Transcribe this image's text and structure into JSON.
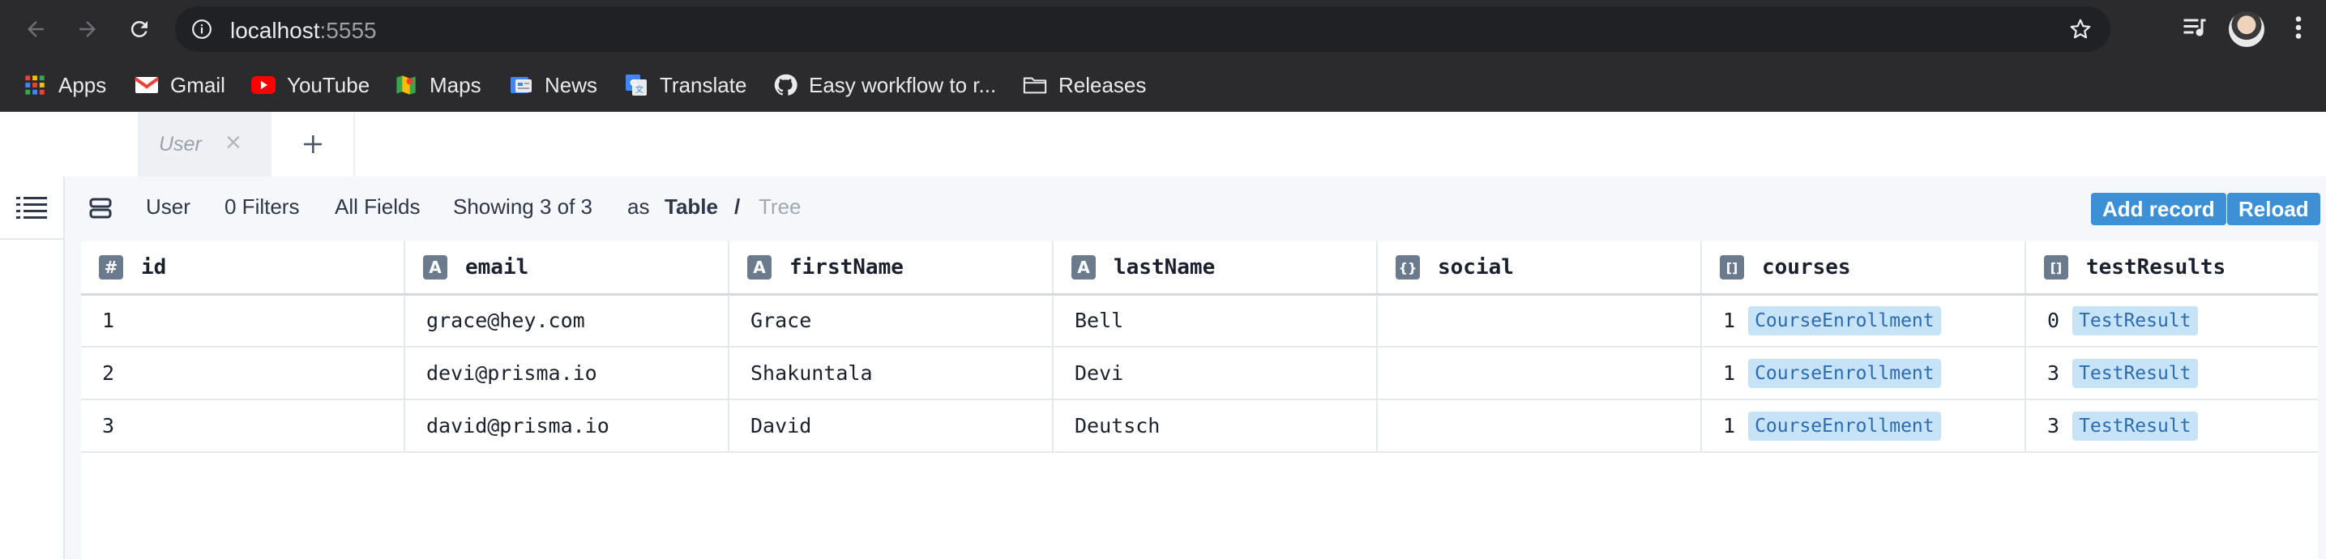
{
  "browser": {
    "url_host": "localhost",
    "url_port": ":5555",
    "bookmarks": [
      {
        "label": "Apps",
        "icon": "apps-grid-icon"
      },
      {
        "label": "Gmail",
        "icon": "gmail-icon"
      },
      {
        "label": "YouTube",
        "icon": "youtube-icon"
      },
      {
        "label": "Maps",
        "icon": "maps-icon"
      },
      {
        "label": "News",
        "icon": "news-icon"
      },
      {
        "label": "Translate",
        "icon": "translate-icon"
      },
      {
        "label": "Easy workflow to r...",
        "icon": "github-icon"
      },
      {
        "label": "Releases",
        "icon": "folder-icon"
      }
    ]
  },
  "tabs": {
    "active_label": "User",
    "close_glyph": "×",
    "add_glyph": "+"
  },
  "toolbar": {
    "model": "User",
    "filters": "0 Filters",
    "fields": "All Fields",
    "showing": "Showing 3 of 3",
    "as_label": "as",
    "view_table": "Table",
    "view_sep": "/",
    "view_tree": "Tree",
    "add_record": "Add record",
    "reload": "Reload"
  },
  "table": {
    "columns": [
      {
        "name": "id",
        "type_glyph": "#",
        "type": "number"
      },
      {
        "name": "email",
        "type_glyph": "A",
        "type": "string"
      },
      {
        "name": "firstName",
        "type_glyph": "A",
        "type": "string"
      },
      {
        "name": "lastName",
        "type_glyph": "A",
        "type": "string"
      },
      {
        "name": "social",
        "type_glyph": "{}",
        "type": "json"
      },
      {
        "name": "courses",
        "type_glyph": "[]",
        "type": "relation-list"
      },
      {
        "name": "testResults",
        "type_glyph": "[]",
        "type": "relation-list"
      }
    ],
    "rows": [
      {
        "id": "1",
        "email": "grace@hey.com",
        "firstName": "Grace",
        "lastName": "Bell",
        "social": "",
        "courses_count": "1",
        "courses_label": "CourseEnrollment",
        "testResults_count": "0",
        "testResults_label": "TestResult"
      },
      {
        "id": "2",
        "email": "devi@prisma.io",
        "firstName": "Shakuntala",
        "lastName": "Devi",
        "social": "",
        "courses_count": "1",
        "courses_label": "CourseEnrollment",
        "testResults_count": "3",
        "testResults_label": "TestResult"
      },
      {
        "id": "3",
        "email": "david@prisma.io",
        "firstName": "David",
        "lastName": "Deutsch",
        "social": "",
        "courses_count": "1",
        "courses_label": "CourseEnrollment",
        "testResults_count": "3",
        "testResults_label": "TestResult"
      }
    ]
  },
  "colors": {
    "chrome_bg": "#2b2b2d",
    "accent_button": "#3d8fd6",
    "relation_pill": "#c7e3f8"
  }
}
